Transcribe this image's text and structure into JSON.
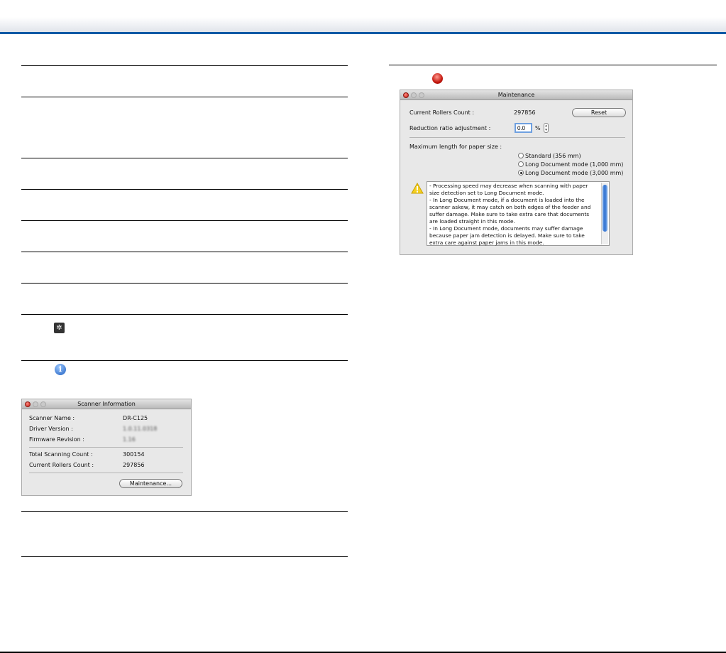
{
  "scanner_info": {
    "title": "Scanner Information",
    "rows": [
      {
        "label": "Scanner Name :",
        "value": "DR-C125"
      },
      {
        "label": "Driver Version :",
        "value": "1.0.11.0318"
      },
      {
        "label": "Firmware Revision :",
        "value": "1.16"
      },
      {
        "label": "Total Scanning Count :",
        "value": "300154"
      },
      {
        "label": "Current Rollers Count :",
        "value": "297856"
      }
    ],
    "maintenance_button": "Maintenance..."
  },
  "maintenance": {
    "title": "Maintenance",
    "rollers_label": "Current Rollers Count :",
    "rollers_value": "297856",
    "reset": "Reset",
    "reduction_label": "Reduction ratio adjustment :",
    "reduction_value": "0.0",
    "percent": "%",
    "max_length_label": "Maximum length for paper size :",
    "options": [
      {
        "label": "Standard (356 mm)",
        "selected": false
      },
      {
        "label": "Long Document mode (1,000 mm)",
        "selected": false
      },
      {
        "label": "Long Document mode (3,000 mm)",
        "selected": true
      }
    ],
    "warning": "- Processing speed may decrease when scanning with paper size detection set to Long Document mode.\n- In Long Document mode, if a document is loaded into the scanner askew, it may catch on both edges of the feeder and suffer damage. Make sure to take extra care that documents are loaded straight in this mode.\n- In Long Document mode, documents may suffer damage because paper jam detection is delayed. Make sure to take extra care against paper jams in this mode."
  },
  "colors": {
    "header_blue": "#0a5aa6"
  }
}
